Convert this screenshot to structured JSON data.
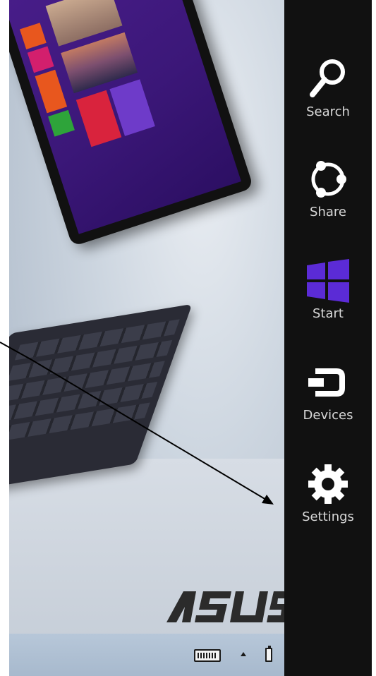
{
  "charms": {
    "search_label": "Search",
    "share_label": "Share",
    "start_label": "Start",
    "devices_label": "Devices",
    "settings_label": "Settings",
    "start_color": "#5b2bd6"
  },
  "brand": {
    "logo_text": "ASUS"
  },
  "tray": {
    "touch_keyboard": "touch-keyboard-icon",
    "show_hidden": "chevron-up-icon",
    "battery": "battery-icon"
  }
}
